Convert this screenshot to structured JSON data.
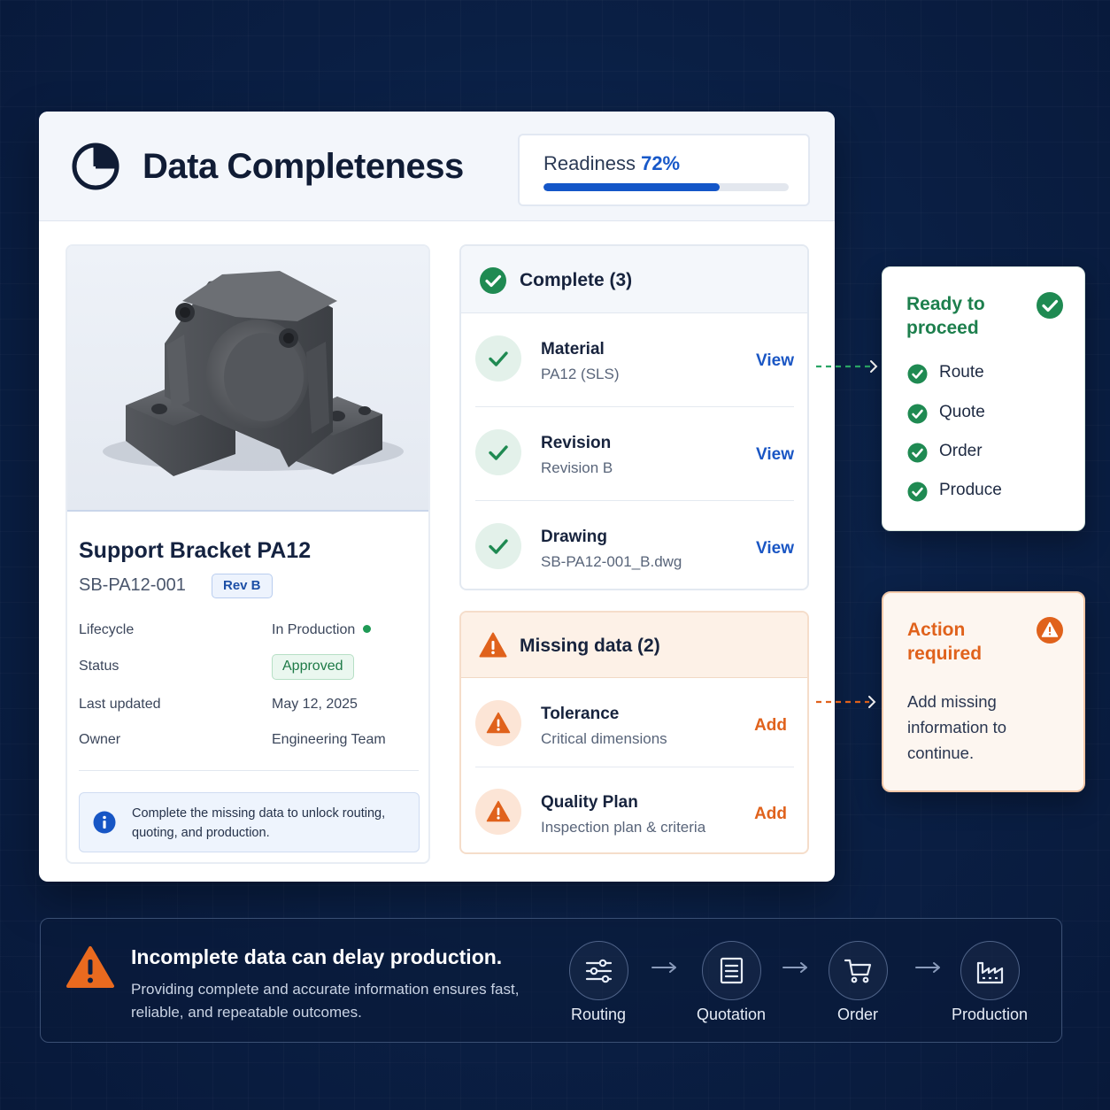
{
  "header": {
    "title": "Data Completeness",
    "readiness_label": "Readiness",
    "readiness_value": "72%",
    "readiness_fraction": 0.72
  },
  "product": {
    "name": "Support Bracket PA12",
    "part_number": "SB-PA12-001",
    "revision_badge": "Rev B",
    "details": {
      "lifecycle_label": "Lifecycle",
      "lifecycle_value": "In Production",
      "status_label": "Status",
      "status_value": "Approved",
      "updated_label": "Last updated",
      "updated_value": "May 12, 2025",
      "owner_label": "Owner",
      "owner_value": "Engineering Team"
    },
    "info_message": "Complete the missing data to unlock routing, quoting, and production."
  },
  "complete": {
    "title": "Complete (3)",
    "items": [
      {
        "title": "Material",
        "subtitle": "PA12 (SLS)",
        "action": "View"
      },
      {
        "title": "Revision",
        "subtitle": "Revision B",
        "action": "View"
      },
      {
        "title": "Drawing",
        "subtitle": "SB-PA12-001_B.dwg",
        "action": "View"
      }
    ]
  },
  "missing": {
    "title": "Missing data (2)",
    "items": [
      {
        "title": "Tolerance",
        "subtitle": "Critical dimensions",
        "action": "Add"
      },
      {
        "title": "Quality Plan",
        "subtitle": "Inspection plan & criteria",
        "action": "Add"
      }
    ]
  },
  "ready_card": {
    "title": "Ready to proceed",
    "items": [
      "Route",
      "Quote",
      "Order",
      "Produce"
    ]
  },
  "action_card": {
    "title": "Action required",
    "message": "Add missing information to continue."
  },
  "banner": {
    "title": "Incomplete data can delay production.",
    "subtitle": "Providing complete and accurate information ensures fast, reliable, and repeatable outcomes.",
    "steps": [
      "Routing",
      "Quotation",
      "Order",
      "Production"
    ]
  },
  "colors": {
    "background": "#0a1f44",
    "accent_blue": "#1456c8",
    "success_green": "#1f8a52",
    "warning_orange": "#e0621c"
  },
  "icons": {
    "header": "pie-chart-icon",
    "complete": "check-circle-icon",
    "missing": "warning-triangle-icon",
    "info": "info-icon",
    "steps": [
      "routing-icon",
      "document-icon",
      "cart-icon",
      "factory-icon"
    ]
  }
}
